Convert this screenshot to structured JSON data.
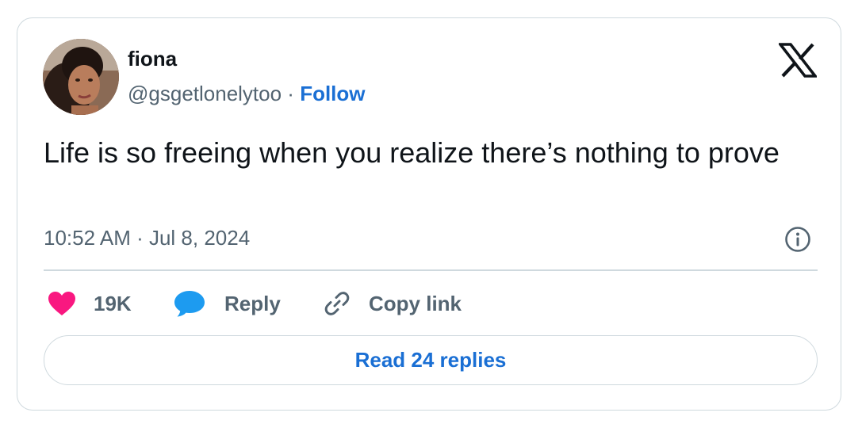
{
  "author": {
    "display_name": "fiona",
    "handle": "@gsgetlonelytoo",
    "separator": " · ",
    "follow_label": "Follow"
  },
  "tweet": {
    "text": "Life is so freeing when you realize there’s nothing to prove",
    "timestamp": "10:52 AM · Jul 8, 2024"
  },
  "actions": {
    "like_count": "19K",
    "reply_label": "Reply",
    "copy_link_label": "Copy link"
  },
  "read_replies_label": "Read 24 replies",
  "icons": {
    "brand": "x-logo-icon",
    "info": "info-icon",
    "like": "heart-icon",
    "reply": "speech-bubble-icon",
    "copy": "link-icon"
  },
  "colors": {
    "like": "#f91880",
    "reply": "#1d9bf0",
    "link_blue": "#1a6fd4",
    "secondary_text": "#536471",
    "border": "#cfd9de"
  }
}
